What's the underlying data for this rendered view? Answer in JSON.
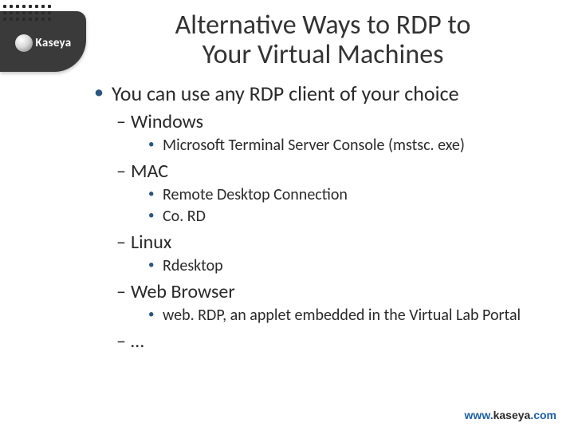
{
  "brand": {
    "name": "Kaseya",
    "footer_prefix": "www.",
    "footer_mid": "kaseya",
    "footer_suffix": ".com"
  },
  "title_line1": "Alternative Ways to RDP to",
  "title_line2": "Your Virtual Machines",
  "bullets": {
    "main": "You can use any RDP client of your choice",
    "windows_label": "Windows",
    "windows_item1": "Microsoft Terminal Server Console (mstsc. exe)",
    "mac_label": "MAC",
    "mac_item1": "Remote Desktop Connection",
    "mac_item2": "Co. RD",
    "linux_label": "Linux",
    "linux_item1": "Rdesktop",
    "web_label": "Web Browser",
    "web_item1": "web. RDP, an applet embedded in the Virtual Lab Portal",
    "more_label": "…"
  }
}
